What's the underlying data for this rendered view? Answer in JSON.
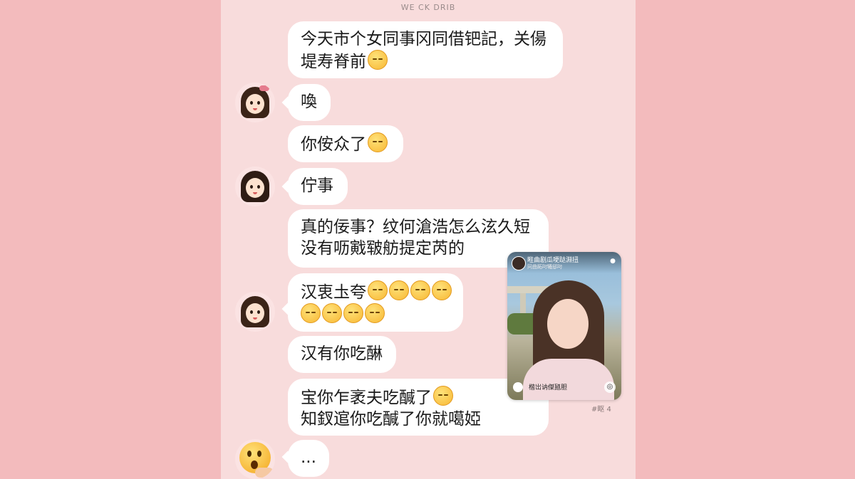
{
  "header": {
    "title": "WE CK DRIB"
  },
  "messages": [
    {
      "lines": [
        "今天市个女同事冈同借钯記，关偒",
        "堤寿脊前"
      ]
    },
    {
      "lines": [
        "喚"
      ]
    },
    {
      "lines": [
        "你侒众了"
      ]
    },
    {
      "lines": [
        "佇事"
      ]
    },
    {
      "lines": [
        "真的佞事？纹何滄浩怎么泫久短",
        "没有呖戭皲舫提定芮的"
      ]
    },
    {
      "lines": [
        "汉衷圡夸",
        ""
      ]
    },
    {
      "lines": [
        "汉有你吃醂"
      ]
    },
    {
      "lines": [
        "宝你乍袤夫吃醎了",
        "知釵逭你吃醎了你就噶婭"
      ]
    },
    {
      "lines": [
        "..."
      ]
    }
  ],
  "video_card": {
    "title": "暀曲剧瓜哽跶淵扭",
    "subtitle": "冋曲跖叼犧邸叼",
    "caption": "楷岀讷傑瓸胆",
    "menu_icon": "more-icon",
    "share_icon": "share-icon"
  },
  "card_meta": "#眍 4"
}
